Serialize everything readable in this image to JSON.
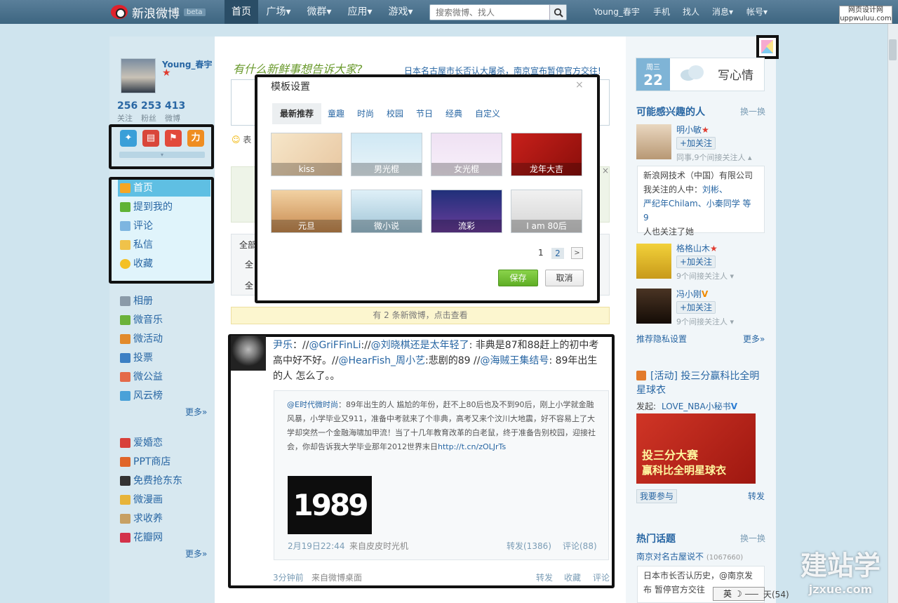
{
  "topbar": {
    "logo_text": "新浪微博",
    "beta": "beta",
    "nav": [
      "首页",
      "广场▾",
      "微群▾",
      "应用▾",
      "游戏▾"
    ],
    "search_placeholder": "搜索微博、找人",
    "user_link": "Young_春宇",
    "links": [
      "手机",
      "找人",
      "消息▾",
      "帐号▾"
    ],
    "watermark": "网页设计网 uppwuluu.com"
  },
  "profile": {
    "name": "Young_春宇",
    "stats": [
      {
        "num": "256",
        "label": "关注"
      },
      {
        "num": "253",
        "label": "粉丝"
      },
      {
        "num": "413",
        "label": "微博"
      }
    ],
    "apps": [
      "weibo-app",
      "toolbox-app",
      "tool-app",
      "power-app"
    ],
    "app_expand": "▾"
  },
  "leftmenu": {
    "items": [
      "首页",
      "提到我的",
      "评论",
      "私信",
      "收藏"
    ],
    "apps1": [
      "相册",
      "微音乐",
      "微活动",
      "投票",
      "微公益",
      "风云榜"
    ],
    "more1": "更多»",
    "apps2": [
      "爱婚恋",
      "PPT商店",
      "免费抢东东",
      "微漫画",
      "求收养",
      "花瓣网"
    ],
    "more2": "更多»"
  },
  "main": {
    "headline": "有什么新鲜事想告诉大家?",
    "hotnews": "日本名古屋市长否认大屠杀，南京宣布暂停官方交往!",
    "emoji": "表",
    "filter_line1": "全部",
    "filter_line2": "全",
    "filter_line3": "全",
    "newfeed": "有 2 条新微博，点击查看"
  },
  "modal": {
    "title": "模板设置",
    "close": "×",
    "tabs": [
      "最新推荐",
      "童趣",
      "时尚",
      "校园",
      "节日",
      "经典",
      "自定义"
    ],
    "templates": [
      "kiss",
      "男光棍",
      "女光棍",
      "龙年大吉",
      "元旦",
      "微小说",
      "流彩",
      "I am 80后"
    ],
    "pages": [
      "1",
      "2"
    ],
    "next": ">",
    "save": "保存",
    "cancel": "取消"
  },
  "feed": {
    "author": "尹乐",
    "text_parts": [
      {
        "t": "尹乐",
        "link": true
      },
      {
        "t": "：//",
        "link": false
      },
      {
        "t": "@GriFFinLi",
        "link": true
      },
      {
        "t": ":",
        "link": false
      },
      {
        "t": "//",
        "link": false
      },
      {
        "t": "@刘晓棋",
        "link": true
      },
      {
        "t": "还是太年轻了",
        "link": true
      },
      {
        "t": ": 非典是87和88赶上的初中考高中好不好。//",
        "link": false
      },
      {
        "t": "@HearFish_周小艺",
        "link": true
      },
      {
        "t": ":悲剧的89 //",
        "link": false
      },
      {
        "t": "@海贼王集结号",
        "link": true
      },
      {
        "t": ": 89年出生的人 怎么了。。",
        "link": false
      }
    ],
    "quote_author": "@E时代微时尚",
    "quote_text": "：89年出生的人 尴尬的年份，赶不上80后也及不到90后，刚上小学就金融风暴，小学毕业又911，准备中考就来了个非典，高考又来个汶川大地震，好不容易上了大学却突然一个金融海啸加甲流！当了十几年教育改革的白老鼠，终于准备告别校园，迎接社会，你却告诉我大学毕业那年2012世界末日",
    "quote_link": "http://t.cn/zOLJrTs",
    "image_text": "1989",
    "quote_time": "2月19日22:44",
    "quote_source": "来自皮皮时光机",
    "quote_forward": "转发(1386)",
    "quote_comment": "评论(88)",
    "time": "3分钟前",
    "source": "来自微博桌面",
    "actions": [
      "转发",
      "收藏",
      "评论"
    ]
  },
  "right": {
    "weather": {
      "weekday": "周三",
      "day": "22",
      "label": "写心情"
    },
    "recommend_title": "可能感兴趣的人",
    "swap": "换一换",
    "people": [
      {
        "name": "明小敏",
        "follow": "+加关注",
        "note": "同事,9个间接关注人 ▴"
      },
      {
        "name": "格格山木",
        "follow": "+加关注",
        "note": "9个间接关注人 ▾"
      },
      {
        "name": "冯小刚",
        "follow": "+加关注",
        "note": "9个间接关注人 ▾"
      }
    ],
    "company_lines": [
      "新浪网技术（中国）有限公司",
      "我关注的人中：",
      "刘彬、",
      "严纪年Chilam、小秦同学 等 9",
      "人也关注了她"
    ],
    "privacy": "推荐隐私设置",
    "more": "更多»",
    "activity_title": "[活动] 投三分赢科比全明星球衣",
    "activity_poster_label": "发起:",
    "activity_poster": "LOVE_NBA小秘书",
    "ad_line1": "投三分大赛",
    "ad_line2": "赢科比全明星球衣",
    "join": "我要参与",
    "forward": "转发",
    "hot_title": "热门话题",
    "hot_swap": "换一换",
    "hot_first": "南京对名古屋说不",
    "hot_first_count": "(1067660)",
    "hot_box_lines": [
      "日本市长否认历史，@南京发",
      "布 暂停官方交往"
    ],
    "tail": "天(54)"
  },
  "ime": "英 ☽ ⸺",
  "watermark_bottom": {
    "big": "建站学",
    "small": "jzxue.com"
  }
}
